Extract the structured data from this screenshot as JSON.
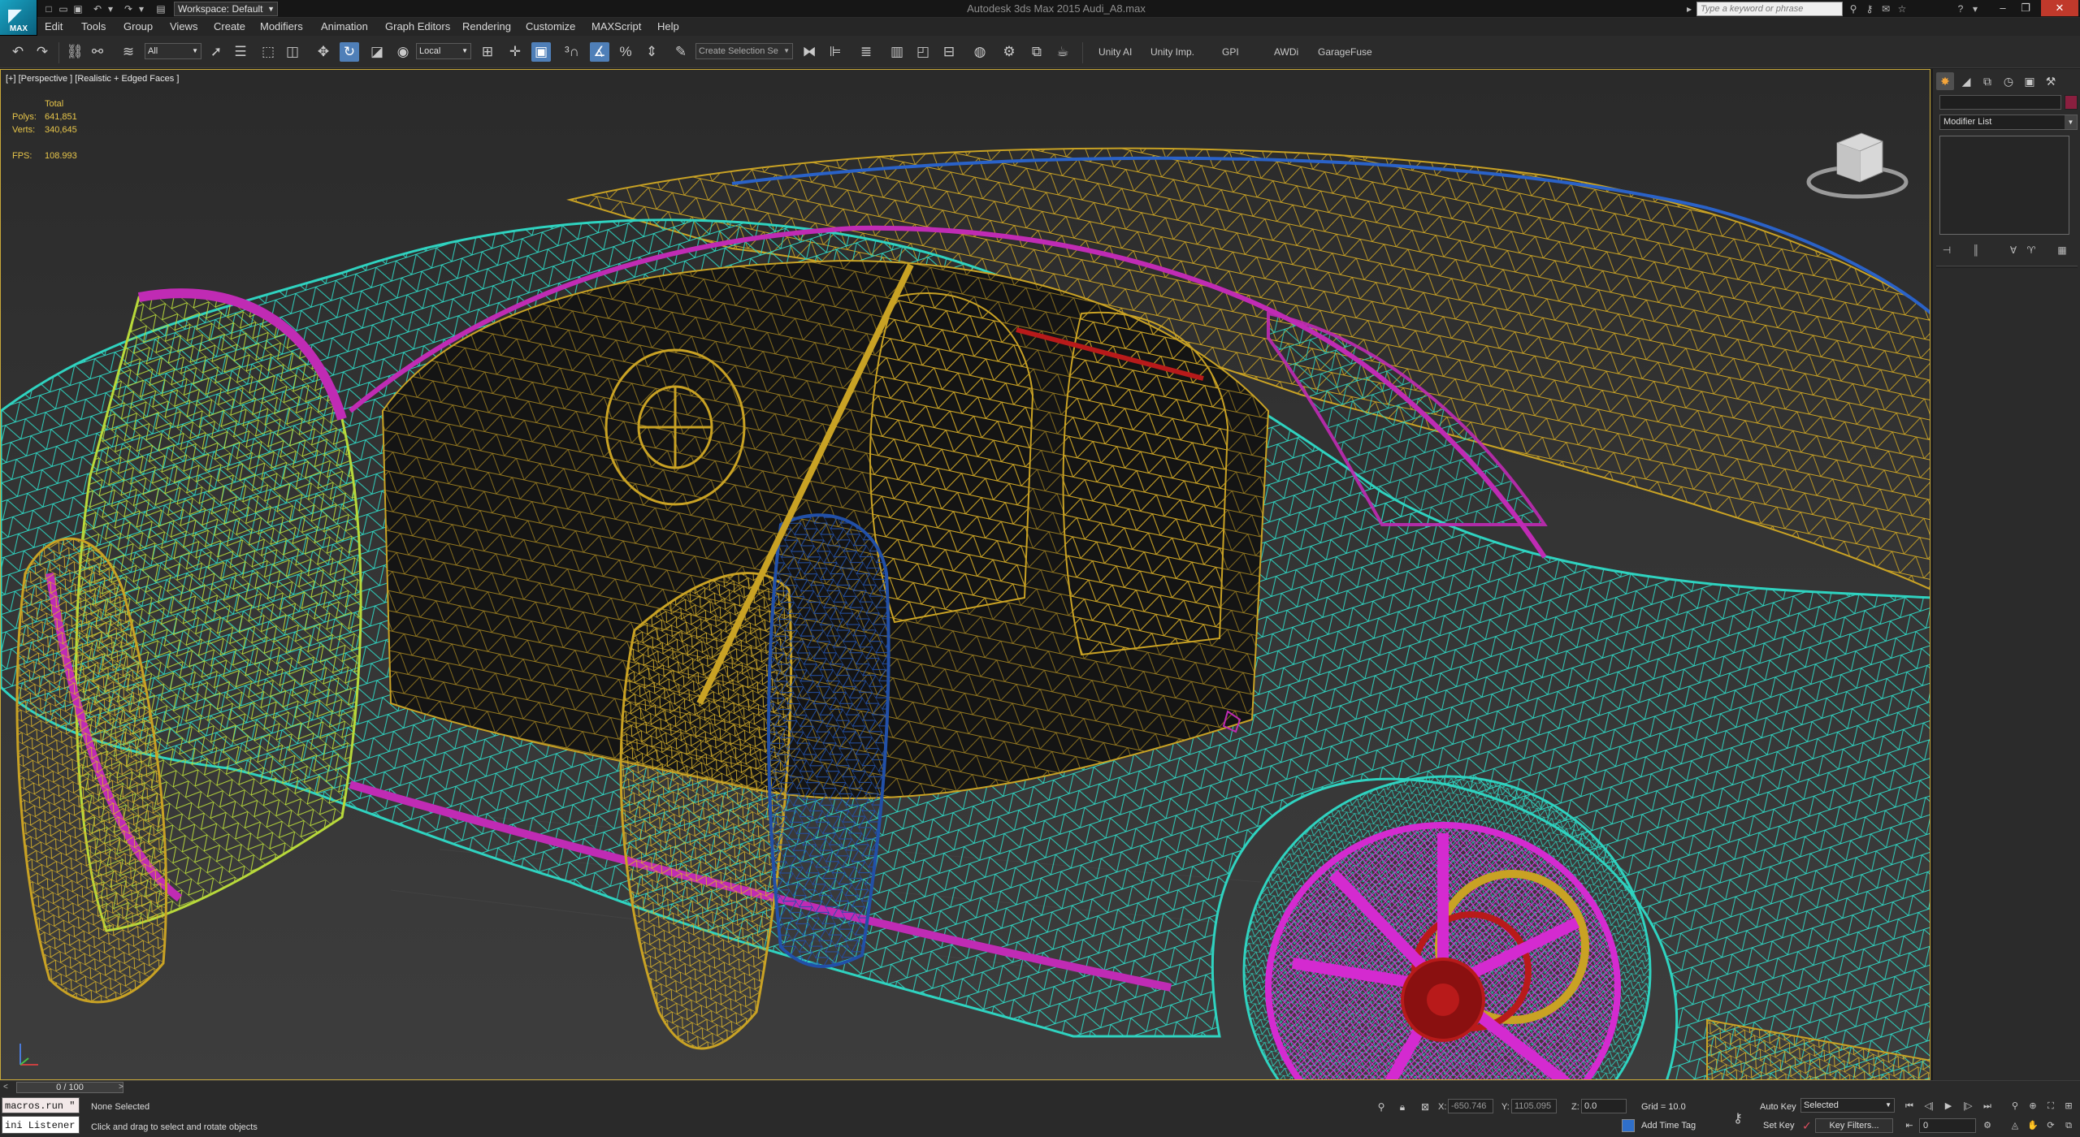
{
  "app": {
    "logo_label": "MAX",
    "window_title": "Autodesk 3ds Max 2015    Audi_A8.max",
    "workspace_value": "Workspace: Default",
    "search_placeholder": "Type a keyword or phrase"
  },
  "menu": {
    "items": [
      "Edit",
      "Tools",
      "Group",
      "Views",
      "Create",
      "Modifiers",
      "Animation",
      "Graph Editors",
      "Rendering",
      "Customize",
      "MAXScript",
      "Help"
    ]
  },
  "toolbar": {
    "selection_filter": "All",
    "ref_coord": "Local",
    "named_selection": "Create Selection Se",
    "custom_tabs": [
      "Unity AI",
      "Unity Imp.",
      "GPI",
      "AWDi",
      "GarageFuse"
    ]
  },
  "viewport": {
    "label": "[+] [Perspective ] [Realistic + Edged Faces ]",
    "stats": {
      "header": "Total",
      "polys_label": "Polys:",
      "polys_value": "641,851",
      "verts_label": "Verts:",
      "verts_value": "340,645",
      "fps_label": "FPS:",
      "fps_value": "108.993"
    },
    "wire_colors": {
      "body": "#2fd3c0",
      "interior": "#c9a224",
      "door_front": "#b8d93a",
      "door_magenta": "#c02bb4",
      "door_blue": "#2250a8",
      "rim": "#d42ad0",
      "brake": "#b81a1a",
      "roof_edge": "#2a62c8"
    }
  },
  "command_panel": {
    "modifier_list": "Modifier List",
    "object_color": "#8a1f3f"
  },
  "timeline": {
    "frame_display": "0 / 100"
  },
  "status": {
    "listener_top": "macros.run \"",
    "listener_bottom": "ini Listener",
    "selection": "None Selected",
    "prompt": "Click and drag to select and rotate objects",
    "x_label": "X:",
    "x_value": "-650.746",
    "y_label": "Y:",
    "y_value": "1105.095",
    "z_label": "Z:",
    "z_value": "0.0",
    "grid": "Grid = 10.0",
    "add_time_tag": "Add Time Tag",
    "auto_key": "Auto Key",
    "key_mode": "Selected",
    "set_key": "Set Key",
    "key_filters": "Key Filters...",
    "frame": "0"
  }
}
